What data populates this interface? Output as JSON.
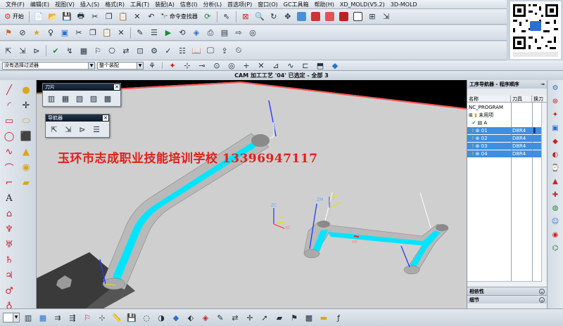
{
  "menu": [
    "文件(F)",
    "编辑(E)",
    "视图(V)",
    "插入(S)",
    "格式(R)",
    "工具(T)",
    "装配(A)",
    "信息(I)",
    "分析(L)",
    "首选项(P)",
    "窗口(O)",
    "GC工具箱",
    "帮助(H)",
    "XD_MOLD(V5.2)",
    "3D-MOLD"
  ],
  "toolbar1": {
    "start_label": "开始",
    "find_command_label": "命令查找器"
  },
  "filterbar": {
    "selection_filter": "没有选择过滤器",
    "scope": "整个装配"
  },
  "title": "CAM 加工工艺 '04' 已选定 - 全部 3",
  "watermark": "玉环市志成职业技能培训学校  13396947117",
  "palettes": {
    "tool": "刀片",
    "navigator": "导航器"
  },
  "navigator": {
    "title": "工序导航器 - 程序顺序",
    "columns": [
      "名称",
      "刀具",
      "换刀"
    ],
    "rows": [
      {
        "name": "NC_PROGRAM",
        "tool": "",
        "selected": false
      },
      {
        "name": "未用项",
        "tool": "",
        "selected": false
      },
      {
        "name": "A",
        "tool": "",
        "selected": false
      },
      {
        "name": "01",
        "tool": "D8R4",
        "selected": true
      },
      {
        "name": "02",
        "tool": "D8R4",
        "selected": true
      },
      {
        "name": "03",
        "tool": "D8R4",
        "selected": true
      },
      {
        "name": "04",
        "tool": "D8R4",
        "selected": true
      }
    ],
    "sections": [
      "相依性",
      "细节"
    ]
  },
  "axes": {
    "zc": "ZC",
    "yc": "YC",
    "xc": "XC",
    "zm": "ZM",
    "ym": "YM",
    "xm": "XM"
  },
  "colors": {
    "cyan_path": "#00e5ff",
    "part_gray": "#d8d8d8",
    "watermark_red": "#e0201a",
    "selection_blue": "#3f8fe0"
  }
}
